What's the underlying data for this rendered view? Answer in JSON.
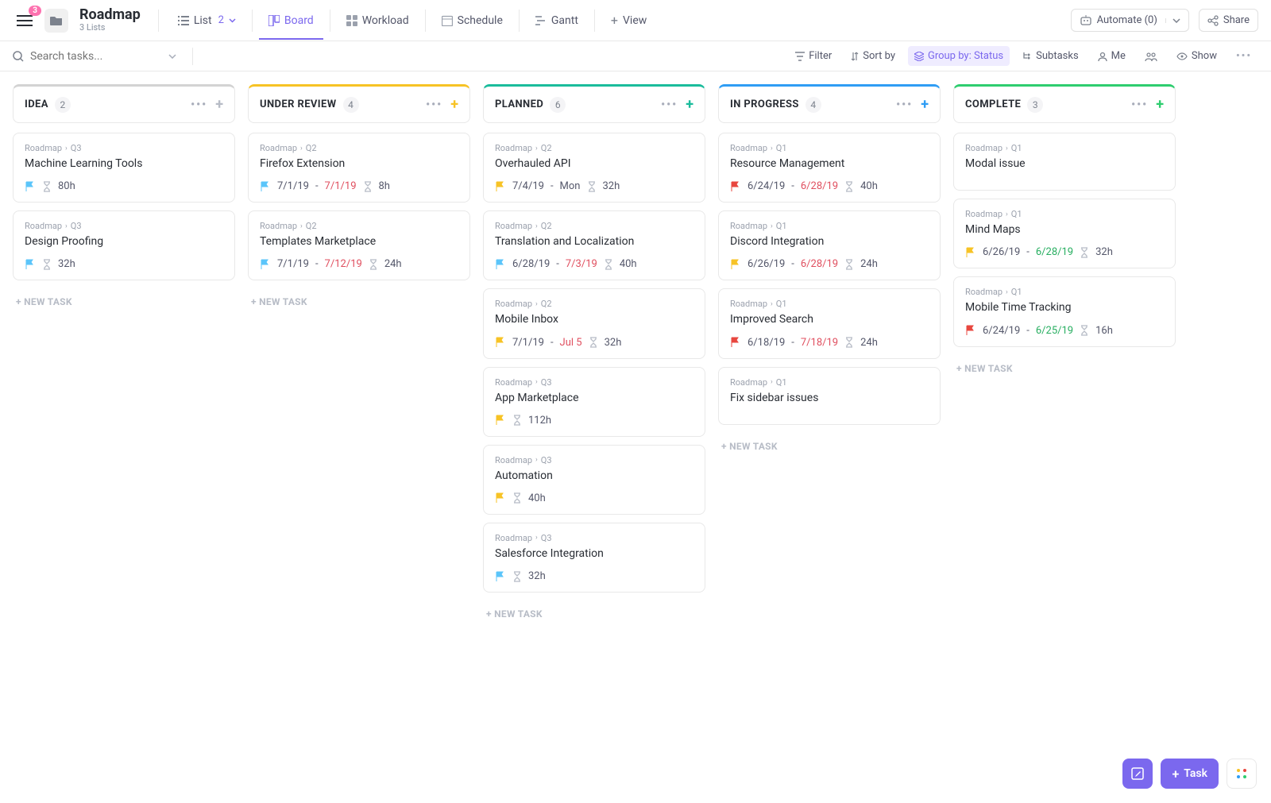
{
  "header": {
    "menu_badge": "3",
    "title": "Roadmap",
    "subtitle": "3 Lists",
    "views": [
      {
        "key": "list",
        "label": "List",
        "count": "2"
      },
      {
        "key": "board",
        "label": "Board",
        "active": true
      },
      {
        "key": "workload",
        "label": "Workload"
      },
      {
        "key": "schedule",
        "label": "Schedule"
      },
      {
        "key": "gantt",
        "label": "Gantt"
      }
    ],
    "add_view_label": "View",
    "automate_label": "Automate (0)",
    "share_label": "Share"
  },
  "toolbar": {
    "search_placeholder": "Search tasks...",
    "filter": "Filter",
    "sort": "Sort by",
    "group": "Group by: Status",
    "subtasks": "Subtasks",
    "me": "Me",
    "show": "Show"
  },
  "new_task_label": "+ NEW TASK",
  "columns": [
    {
      "title": "IDEA",
      "count": "2",
      "color": "#d3d3d3",
      "plus_color": "#b7bcc6",
      "cards": [
        {
          "crumb1": "Roadmap",
          "crumb2": "Q3",
          "title": "Machine Learning Tools",
          "flag": "#5bc5fa",
          "time": "80h"
        },
        {
          "crumb1": "Roadmap",
          "crumb2": "Q3",
          "title": "Design Proofing",
          "flag": "#5bc5fa",
          "time": "32h"
        }
      ]
    },
    {
      "title": "UNDER REVIEW",
      "count": "4",
      "color": "#f7c325",
      "plus_color": "#f7c325",
      "cards": [
        {
          "crumb1": "Roadmap",
          "crumb2": "Q2",
          "title": "Firefox Extension",
          "flag": "#5bc5fa",
          "date1": "7/1/19",
          "dash": " - ",
          "date2": "7/1/19",
          "date2_red": true,
          "time": "8h"
        },
        {
          "crumb1": "Roadmap",
          "crumb2": "Q2",
          "title": "Templates Marketplace",
          "flag": "#5bc5fa",
          "date1": "7/1/19",
          "dash": " - ",
          "date2": "7/12/19",
          "date2_red": true,
          "time": "24h"
        }
      ]
    },
    {
      "title": "PLANNED",
      "count": "6",
      "color": "#1bbc9c",
      "plus_color": "#1bbc9c",
      "cards": [
        {
          "crumb1": "Roadmap",
          "crumb2": "Q2",
          "title": "Overhauled API",
          "flag": "#f7c325",
          "date1": "7/4/19",
          "dash": " - ",
          "date2": "Mon",
          "time": "32h"
        },
        {
          "crumb1": "Roadmap",
          "crumb2": "Q2",
          "title": "Translation and Localization",
          "flag": "#5bc5fa",
          "date1": "6/28/19",
          "dash": " - ",
          "date2": "7/3/19",
          "date2_red": true,
          "time": "40h"
        },
        {
          "crumb1": "Roadmap",
          "crumb2": "Q2",
          "title": "Mobile Inbox",
          "flag": "#f7c325",
          "date1": "7/1/19",
          "dash": " - ",
          "date2": "Jul 5",
          "date2_red": true,
          "time": "32h"
        },
        {
          "crumb1": "Roadmap",
          "crumb2": "Q3",
          "title": "App Marketplace",
          "flag": "#f7c325",
          "time": "112h"
        },
        {
          "crumb1": "Roadmap",
          "crumb2": "Q3",
          "title": "Automation",
          "flag": "#f7c325",
          "time": "40h"
        },
        {
          "crumb1": "Roadmap",
          "crumb2": "Q3",
          "title": "Salesforce Integration",
          "flag": "#5bc5fa",
          "time": "32h"
        }
      ]
    },
    {
      "title": "IN PROGRESS",
      "count": "4",
      "color": "#2f9df4",
      "plus_color": "#2f9df4",
      "cards": [
        {
          "crumb1": "Roadmap",
          "crumb2": "Q1",
          "title": "Resource Management",
          "flag": "#e8473f",
          "date1": "6/24/19",
          "dash": " - ",
          "date2": "6/28/19",
          "date2_red": true,
          "time": "40h"
        },
        {
          "crumb1": "Roadmap",
          "crumb2": "Q1",
          "title": "Discord Integration",
          "flag": "#f7c325",
          "date1": "6/26/19",
          "dash": " - ",
          "date2": "6/28/19",
          "date2_red": true,
          "time": "24h"
        },
        {
          "crumb1": "Roadmap",
          "crumb2": "Q1",
          "title": "Improved Search",
          "flag": "#e8473f",
          "date1": "6/18/19",
          "dash": " - ",
          "date2": "7/18/19",
          "date2_red": true,
          "time": "24h"
        },
        {
          "crumb1": "Roadmap",
          "crumb2": "Q1",
          "title": "Fix sidebar issues"
        }
      ]
    },
    {
      "title": "COMPLETE",
      "count": "3",
      "color": "#2ecd6f",
      "plus_color": "#2ecd6f",
      "cards": [
        {
          "crumb1": "Roadmap",
          "crumb2": "Q1",
          "title": "Modal issue"
        },
        {
          "crumb1": "Roadmap",
          "crumb2": "Q1",
          "title": "Mind Maps",
          "flag": "#f7c325",
          "date1": "6/26/19",
          "dash": " - ",
          "date2": "6/28/19",
          "date2_green": true,
          "time": "32h"
        },
        {
          "crumb1": "Roadmap",
          "crumb2": "Q1",
          "title": "Mobile Time Tracking",
          "flag": "#e8473f",
          "date1": "6/24/19",
          "dash": " - ",
          "date2": "6/25/19",
          "date2_green": true,
          "time": "16h"
        }
      ]
    }
  ],
  "fab": {
    "task_label": "Task"
  }
}
